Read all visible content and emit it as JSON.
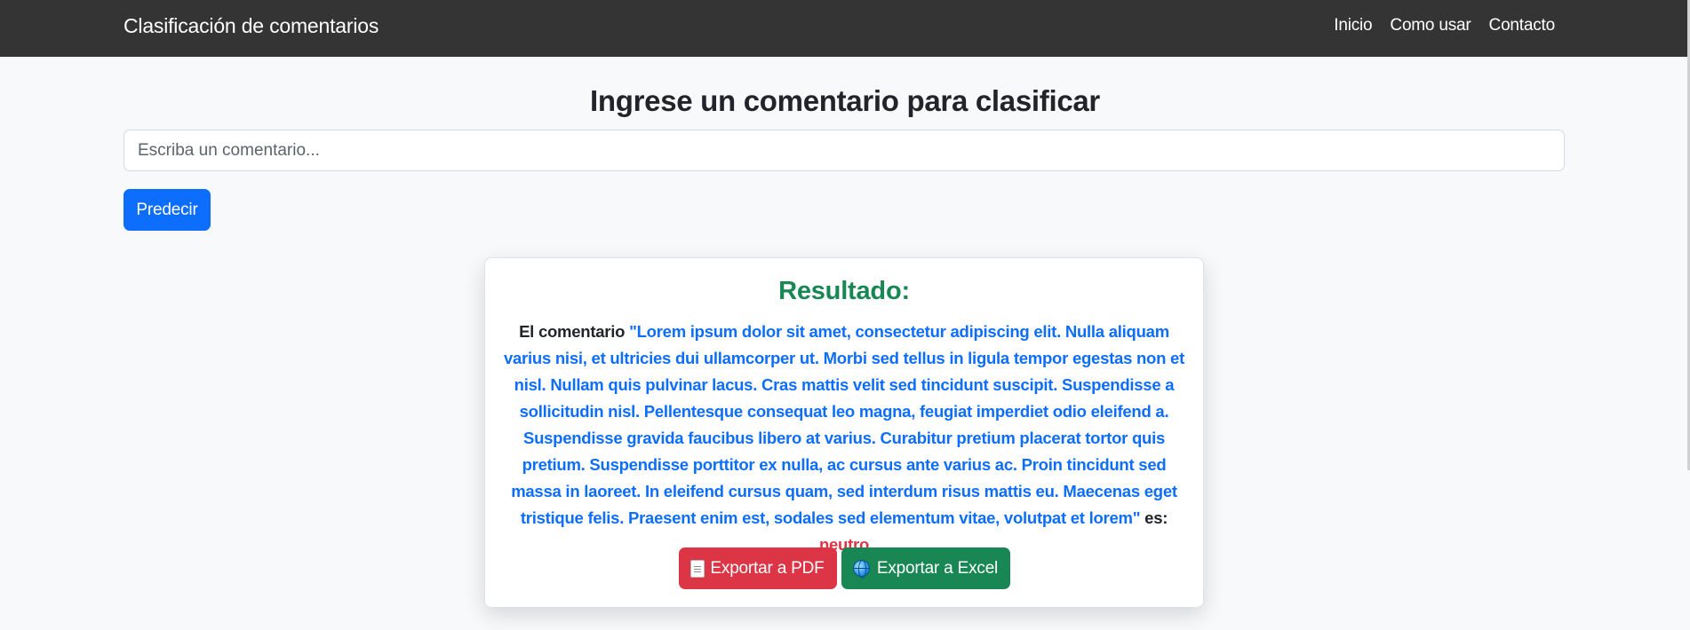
{
  "navbar": {
    "brand": "Clasificación de comentarios",
    "links": [
      "Inicio",
      "Como usar",
      "Contacto"
    ]
  },
  "main": {
    "title": "Ingrese un comentario para clasificar",
    "input_placeholder": "Escriba un comentario...",
    "input_value": "",
    "predict_label": "Predecir"
  },
  "result": {
    "title": "Resultado:",
    "prefix": "El comentario",
    "comment": "\"Lorem ipsum dolor sit amet, consectetur adipiscing elit. Nulla aliquam varius nisi, et ultricies dui ullamcorper ut. Morbi sed tellus in ligula tempor egestas non et nisl. Nullam quis pulvinar lacus. Cras mattis velit sed tincidunt suscipit. Suspendisse a sollicitudin nisl. Pellentesque consequat leo magna, feugiat imperdiet odio eleifend a. Suspendisse gravida faucibus libero at varius. Curabitur pretium placerat tortor quis pretium. Suspendisse porttitor ex nulla, ac cursus ante varius ac. Proin tincidunt sed massa in laoreet. In eleifend cursus quam, sed interdum risus mattis eu. Maecenas eget tristique felis. Praesent enim est, sodales sed elementum vitae, volutpat et lorem\"",
    "connector": "es:",
    "label": "neutro",
    "export_pdf_label": "Exportar a PDF",
    "export_excel_label": "Exportar a Excel",
    "pdf_icon": "document-icon",
    "excel_icon": "globe-icon"
  },
  "colors": {
    "navbar_bg": "#343434",
    "primary": "#0d6efd",
    "success": "#198754",
    "danger": "#dc3545"
  }
}
